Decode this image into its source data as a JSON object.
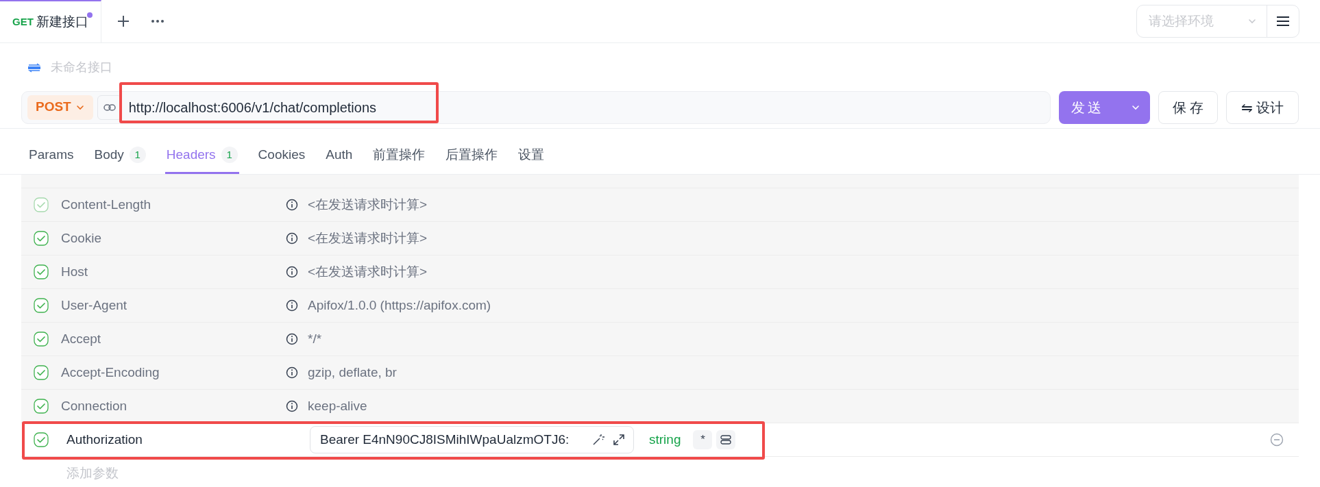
{
  "doc_tabs": [
    {
      "method": "GET",
      "title": "新建接口",
      "unsaved": true,
      "selected": true
    }
  ],
  "env_select": {
    "placeholder": "请选择环境"
  },
  "api_name": {
    "placeholder": "未命名接口"
  },
  "request": {
    "method": "POST",
    "url": "http://localhost:6006/v1/chat/completions",
    "send": "发送",
    "save": "保 存",
    "design": "⇋ 设计"
  },
  "tabs": [
    {
      "label": "Params",
      "selected": false
    },
    {
      "label": "Body",
      "count": "1",
      "selected": false
    },
    {
      "label": "Headers",
      "count": "1",
      "selected": true
    },
    {
      "label": "Cookies",
      "selected": false
    },
    {
      "label": "Auth",
      "selected": false
    },
    {
      "label": "前置操作",
      "selected": false
    },
    {
      "label": "后置操作",
      "selected": false
    },
    {
      "label": "设置",
      "selected": false
    }
  ],
  "auto_headers": [
    {
      "name": "Content-Length",
      "value": "<在发送请求时计算>",
      "checked": true,
      "disabled": true
    },
    {
      "name": "Cookie",
      "value": "<在发送请求时计算>",
      "checked": true,
      "disabled": false
    },
    {
      "name": "Host",
      "value": "<在发送请求时计算>",
      "checked": true,
      "disabled": false
    },
    {
      "name": "User-Agent",
      "value": "Apifox/1.0.0 (https://apifox.com)",
      "checked": true,
      "disabled": false
    },
    {
      "name": "Accept",
      "value": "*/*",
      "checked": true,
      "disabled": false
    },
    {
      "name": "Accept-Encoding",
      "value": "gzip, deflate, br",
      "checked": true,
      "disabled": false
    },
    {
      "name": "Connection",
      "value": "keep-alive",
      "checked": true,
      "disabled": false
    }
  ],
  "custom_headers": [
    {
      "name": "Authorization",
      "value": "Bearer E4nN90CJ8ISMihIWpaUalzmOTJ6:",
      "type": "string",
      "required_mark": "*",
      "checked": true
    }
  ],
  "add_param": {
    "placeholder": "添加参数"
  }
}
